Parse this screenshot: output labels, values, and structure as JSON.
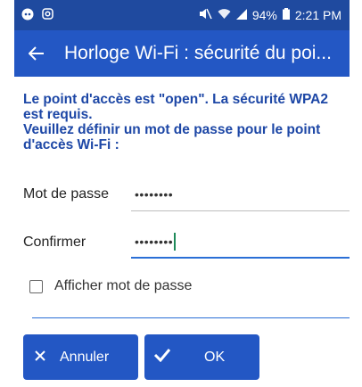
{
  "status_bar": {
    "battery": "94%",
    "time": "2:21 PM"
  },
  "app_bar": {
    "title": "Horloge Wi-Fi : sécurité du poi..."
  },
  "message": "Le point d'accès est \"open\". La sécurité WPA2\nest requis.\nVeuillez définir un mot de passe pour le point\nd'accès Wi-Fi :",
  "form": {
    "password_label": "Mot de passe",
    "password_value": "••••••••",
    "confirm_label": "Confirmer",
    "confirm_value": "••••••••",
    "show_password_label": "Afficher mot de passe",
    "show_password_checked": false
  },
  "buttons": {
    "cancel_label": "Annuler",
    "ok_label": "OK"
  },
  "colors": {
    "status_bar": "#1f4a9f",
    "app_bar": "#2357c4",
    "accent": "#2a6fd6",
    "message_text": "#1d47a6"
  }
}
